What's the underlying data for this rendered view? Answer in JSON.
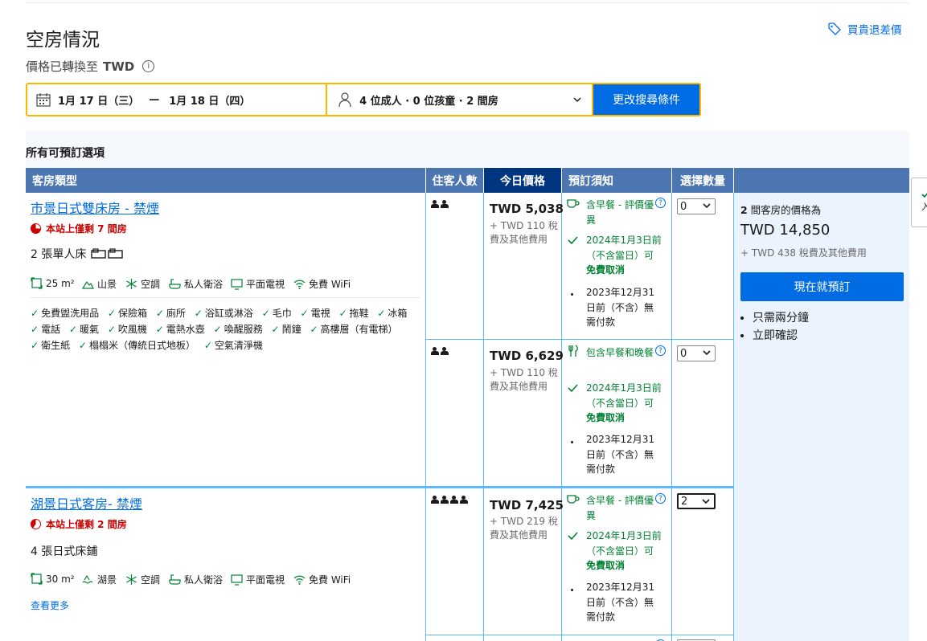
{
  "header": {
    "title": "空房情況",
    "currency_prefix": "價格已轉換至",
    "currency": "TWD",
    "info_icon": "info-icon",
    "price_match": "買貴退差價"
  },
  "search": {
    "checkin": "1月 17 日（三）",
    "separator": "—",
    "checkout": "1月 18 日（四）",
    "guests": "4 位成人 · 0 位孩童 · 2 間房",
    "button": "更改搜尋條件"
  },
  "section_title": "所有可預訂選項",
  "table": {
    "headers": {
      "room_type": "客房類型",
      "guests": "住客人數",
      "today_price": "今日價格",
      "conditions": "預訂須知",
      "select": "選擇數量"
    }
  },
  "rooms": [
    {
      "name": "市景日式雙床房 - 禁煙",
      "scarcity": "本站上僅剩 7 間房",
      "beds": "2 張單人床",
      "facilities": [
        "25 m²",
        "山景",
        "空調",
        "私人衛浴",
        "平面電視",
        "免費 WiFi"
      ],
      "amenities": [
        "免費盥洗用品",
        "保險箱",
        "廁所",
        "浴缸或淋浴",
        "毛巾",
        "電視",
        "拖鞋",
        "冰箱",
        "電話",
        "暖氣",
        "吹風機",
        "電熱水壺",
        "喚醒服務",
        "鬧鐘",
        "高樓層（有電梯）",
        "衛生紙",
        "榻榻米（傳統日式地板）",
        "空氣清淨機"
      ],
      "options": [
        {
          "price": "TWD 5,038",
          "tax": "+ TWD 110 稅費及其他費用",
          "meal": "含早餐 - 評價優異",
          "cancel_date": "2024年1月3日前（不含當日）可",
          "cancel_label": "免費取消",
          "prepay": "2023年12月31日前（不含）無需付款",
          "qty": "0"
        },
        {
          "price": "TWD 6,629",
          "tax": "+ TWD 110 稅費及其他費用",
          "meal": "包含早餐和晚餐",
          "cancel_date": "2024年1月3日前（不含當日）可",
          "cancel_label": "免費取消",
          "prepay": "2023年12月31日前（不含）無需付款",
          "qty": "0"
        }
      ]
    },
    {
      "name": "湖景日式客房- 禁煙",
      "scarcity": "本站上僅剩 2 間房",
      "beds": "4 張日式床鋪",
      "facilities": [
        "30 m²",
        "湖景",
        "空調",
        "私人衛浴",
        "平面電視",
        "免費 WiFi"
      ],
      "see_more": "查看更多",
      "options": [
        {
          "price": "TWD 7,425",
          "tax": "+ TWD 219 稅費及其他費用",
          "meal": "含早餐 - 評價優異",
          "cancel_date": "2024年1月3日前（不含當日）可",
          "cancel_label": "免費取消",
          "prepay": "2023年12月31日前（不含）無需付款",
          "qty": "2"
        }
      ]
    }
  ],
  "summary": {
    "count_prefix": "2",
    "count_suffix": " 間客房的價格為",
    "total": "TWD 14,850",
    "tax": "+ TWD 438 稅費及其他費用",
    "book_button": "現在就預訂",
    "bullets": [
      "只需兩分鐘",
      "立即確認"
    ]
  },
  "edge_tab": {
    "label": "入"
  },
  "colors": {
    "accent": "#006ce4",
    "header_blue": "#4c76b2",
    "dark_blue": "#003580",
    "search_border": "#ffb700",
    "green": "#008234",
    "red": "#cc0000"
  }
}
